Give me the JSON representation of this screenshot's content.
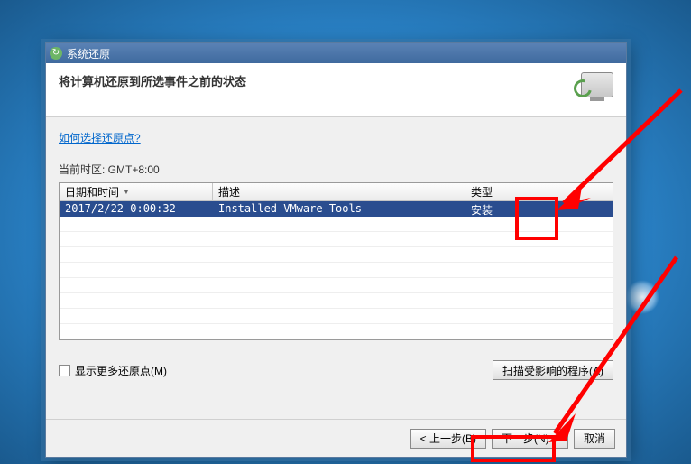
{
  "window": {
    "title": "系统还原"
  },
  "header": {
    "title": "将计算机还原到所选事件之前的状态"
  },
  "content": {
    "help_link": "如何选择还原点?",
    "timezone_label": "当前时区: GMT+8:00",
    "table": {
      "columns": {
        "datetime": "日期和时间",
        "description": "描述",
        "type": "类型"
      },
      "rows": [
        {
          "datetime": "2017/2/22 0:00:32",
          "description": "Installed VMware Tools",
          "type": "安装"
        }
      ]
    },
    "show_more_checkbox": "显示更多还原点(M)",
    "scan_button": "扫描受影响的程序(A)"
  },
  "footer": {
    "back": "< 上一步(B)",
    "next": "下一步(N) >",
    "cancel": "取消"
  }
}
